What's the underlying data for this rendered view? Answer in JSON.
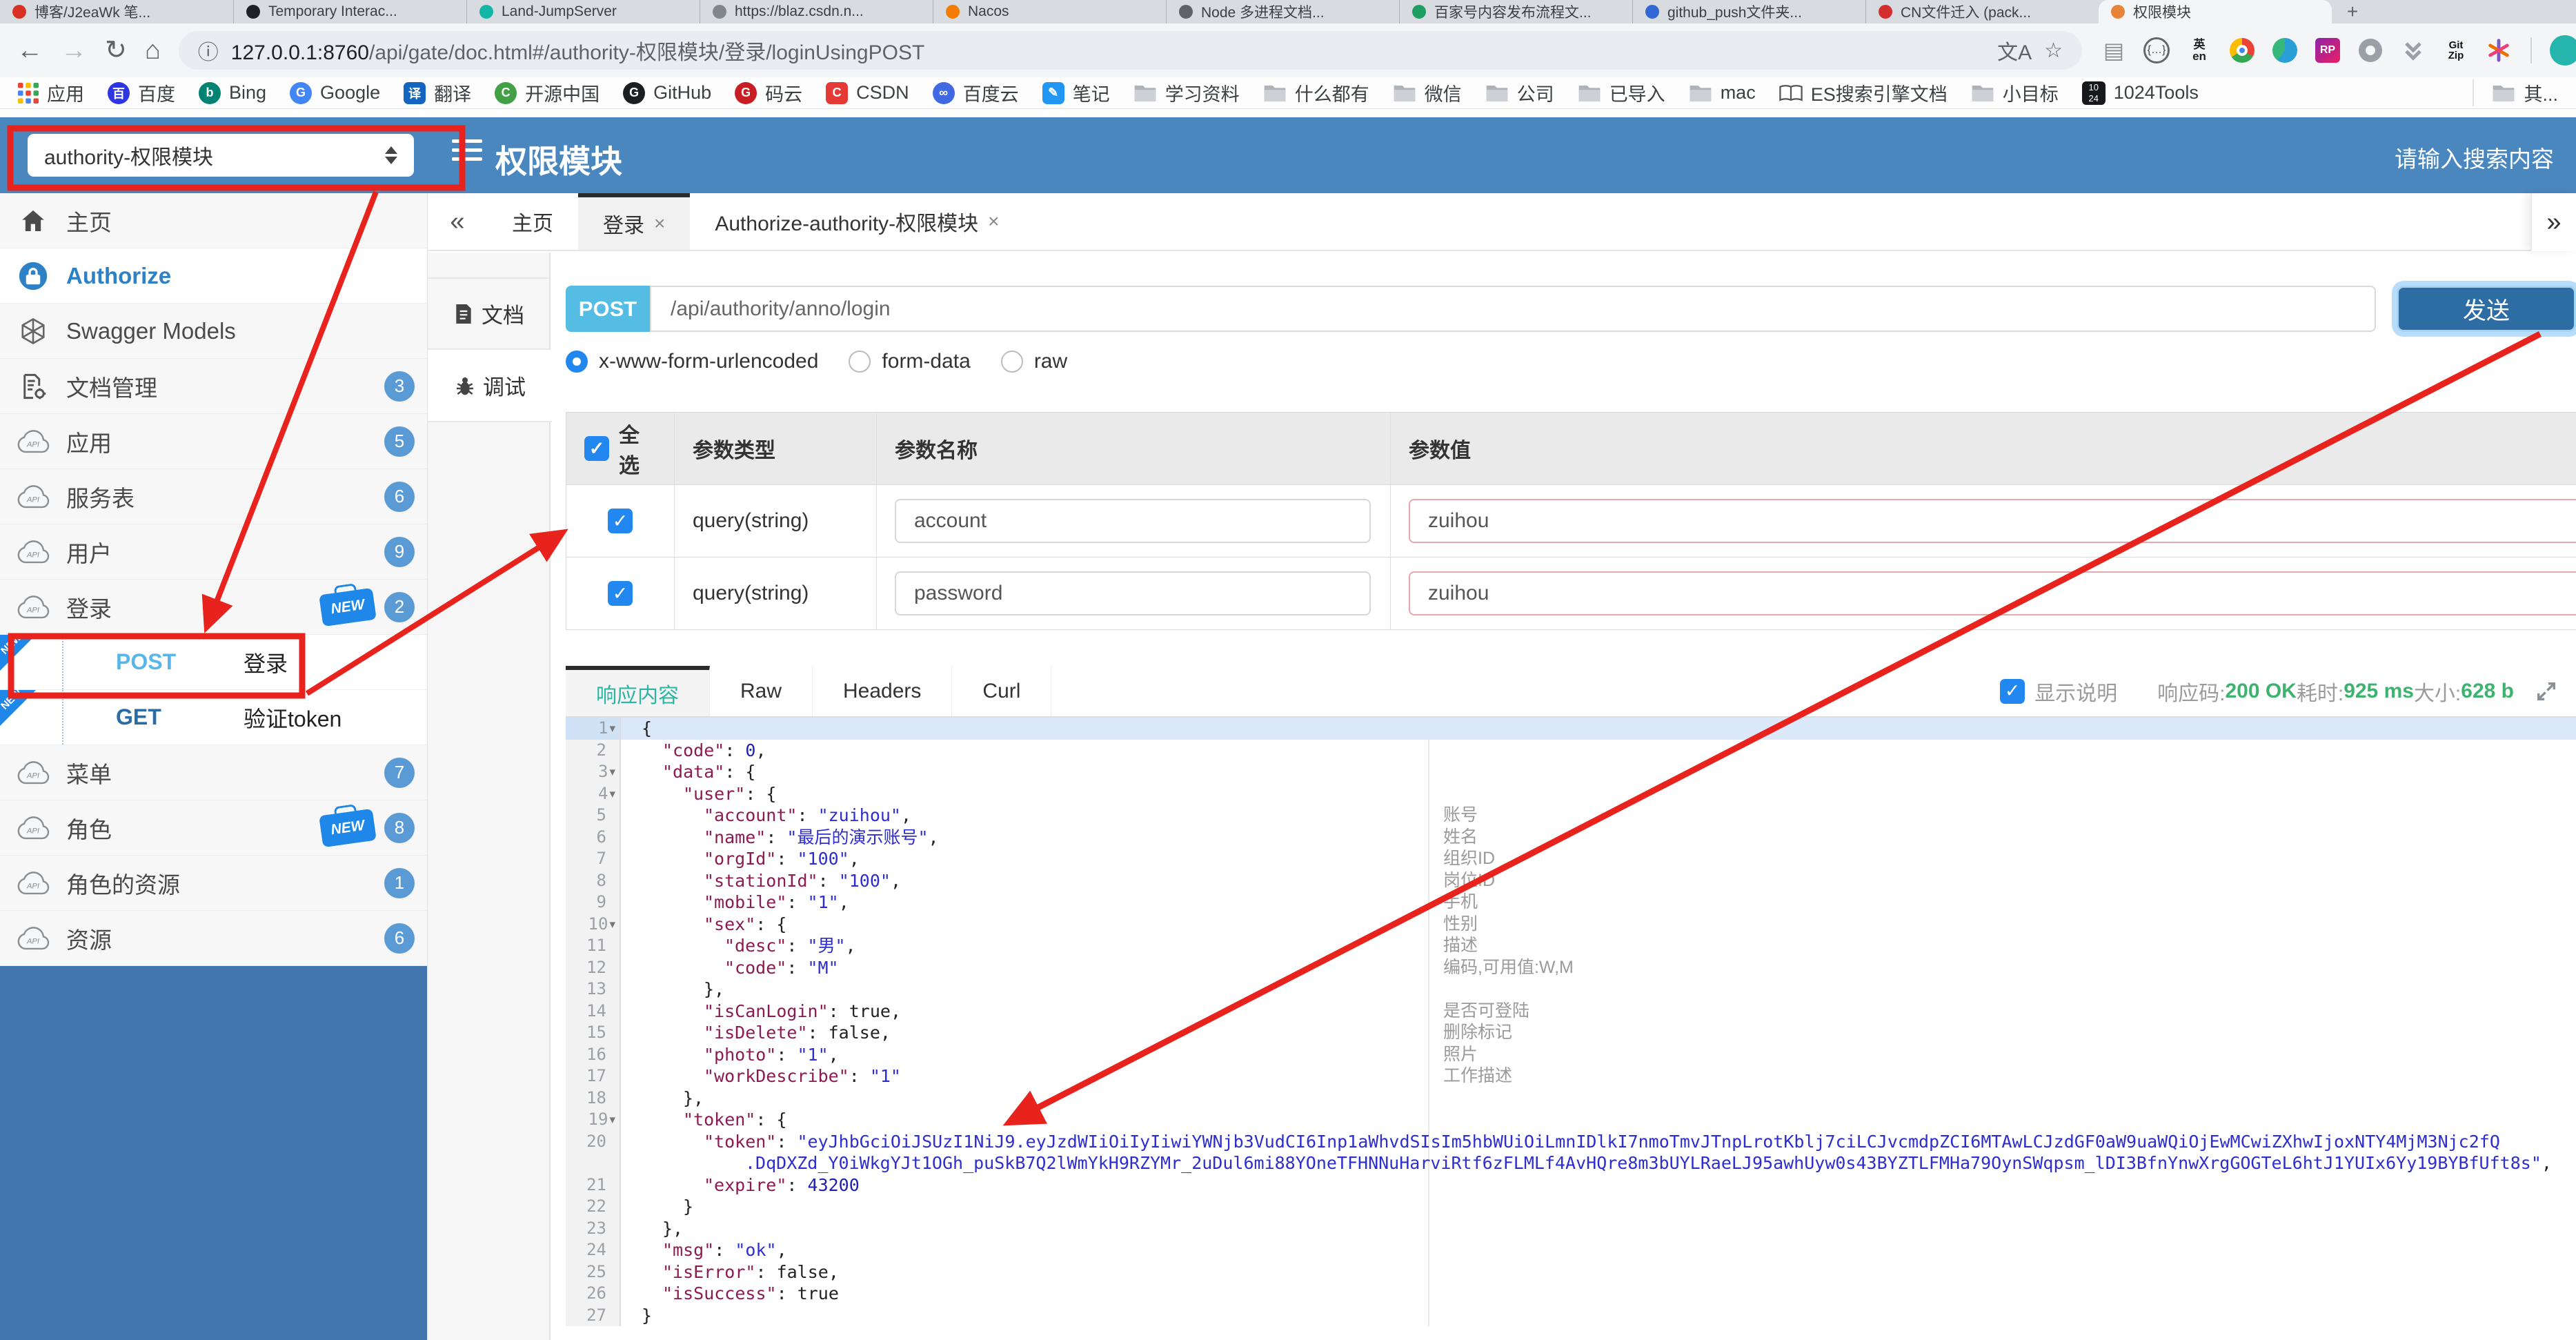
{
  "browser": {
    "tabs": [
      {
        "title": "博客/J2eaWk 笔...",
        "color": "#d93025"
      },
      {
        "title": "Temporary Interac...",
        "color": "#202124"
      },
      {
        "title": "Land-JumpServer",
        "color": "#12b7a6"
      },
      {
        "title": "https://blaz.csdn.n...",
        "color": "#80868b"
      },
      {
        "title": "Nacos",
        "color": "#f57c00"
      },
      {
        "title": "Node 多进程文档...",
        "color": "#5f6368"
      },
      {
        "title": "百家号内容发布流程文...",
        "color": "#1e9e63"
      },
      {
        "title": "github_push文件夹...",
        "color": "#3367d6"
      },
      {
        "title": "CN文件迁入 (pack...",
        "color": "#d32f2f"
      },
      {
        "title": "权限模块",
        "color": "#e8833a",
        "active": true
      }
    ],
    "new_tab_label": "+",
    "nav": {
      "back": "←",
      "forward": "→",
      "reload": "↻",
      "home": "⌂"
    },
    "url": {
      "info": "ⓘ",
      "host": "127.0.0.1:8760",
      "path": "/api/gate/doc.html#/authority-权限模块/登录/loginUsingPOST"
    },
    "actions": {
      "translate": "文A",
      "star": "☆"
    },
    "ext_icons": [
      "page-icon",
      "braces-icon",
      "en-translate-icon",
      "chrome-icon",
      "globe-icon",
      "rp-icon",
      "ring-icon",
      "double-chevron-icon",
      "gitzip-icon",
      "asterisk-icon"
    ],
    "gitzip_label": "Git Zip",
    "bookmarks": [
      {
        "label": "应用",
        "type": "apps"
      },
      {
        "label": "百度",
        "type": "dot",
        "color": "#2d36e0",
        "glyph": "百"
      },
      {
        "label": "Bing",
        "type": "dot",
        "color": "#008373",
        "glyph": "b"
      },
      {
        "label": "Google",
        "type": "dot",
        "color": "#4285f4",
        "glyph": "G"
      },
      {
        "label": "翻译",
        "type": "sq",
        "color": "#1565c0",
        "glyph": "译"
      },
      {
        "label": "开源中国",
        "type": "dot",
        "color": "#43a047",
        "glyph": "C"
      },
      {
        "label": "GitHub",
        "type": "dot",
        "color": "#1b1f23",
        "glyph": "G"
      },
      {
        "label": "码云",
        "type": "dot",
        "color": "#c71d23",
        "glyph": "G"
      },
      {
        "label": "CSDN",
        "type": "sq",
        "color": "#e53935",
        "glyph": "C"
      },
      {
        "label": "百度云",
        "type": "dot",
        "color": "#4169e1",
        "glyph": "∞"
      },
      {
        "label": "笔记",
        "type": "sq",
        "color": "#2196f3",
        "glyph": "✎"
      },
      {
        "label": "学习资料",
        "type": "folder"
      },
      {
        "label": "什么都有",
        "type": "folder"
      },
      {
        "label": "微信",
        "type": "folder"
      },
      {
        "label": "公司",
        "type": "folder"
      },
      {
        "label": "已导入",
        "type": "folder"
      },
      {
        "label": "mac",
        "type": "folder"
      },
      {
        "label": "ES搜索引擎文档",
        "type": "book"
      },
      {
        "label": "小目标",
        "type": "folder"
      },
      {
        "label": "1024Tools",
        "type": "tool1024",
        "glyph_top": "10",
        "glyph_bottom": "24"
      }
    ],
    "bookmarks_overflow": {
      "label": "其...",
      "type": "folder"
    }
  },
  "header": {
    "module_select": "authority-权限模块",
    "title": "权限模块",
    "search_placeholder": "请输入搜索内容"
  },
  "sidebar": {
    "items": [
      {
        "label": "主页",
        "icon": "home"
      },
      {
        "label": "Authorize",
        "icon": "lock",
        "active": true
      },
      {
        "label": "Swagger Models",
        "icon": "hexagon"
      },
      {
        "label": "文档管理",
        "icon": "doc-gear",
        "badge": "3"
      },
      {
        "label": "应用",
        "icon": "cloud",
        "badge": "5"
      },
      {
        "label": "服务表",
        "icon": "cloud",
        "badge": "6"
      },
      {
        "label": "用户",
        "icon": "cloud",
        "badge": "9"
      },
      {
        "label": "登录",
        "icon": "cloud",
        "badge": "2",
        "new": true
      },
      {
        "op": "POST",
        "label": "登录",
        "new": true
      },
      {
        "op": "GET",
        "label": "验证token",
        "new": true
      },
      {
        "label": "菜单",
        "icon": "cloud",
        "badge": "7"
      },
      {
        "label": "角色",
        "icon": "cloud",
        "badge": "8",
        "new": true
      },
      {
        "label": "角色的资源",
        "icon": "cloud",
        "badge": "1"
      },
      {
        "label": "资源",
        "icon": "cloud",
        "badge": "6"
      }
    ],
    "new_label": "NEW"
  },
  "content_tabs": {
    "collapse": "«",
    "expand": "»",
    "close_glyph": "×",
    "tabs": [
      {
        "label": "主页",
        "closable": false
      },
      {
        "label": "登录",
        "closable": true,
        "active": true
      },
      {
        "label": "Authorize-authority-权限模块",
        "closable": true
      }
    ]
  },
  "doc_tabs": [
    {
      "label": "文档",
      "icon": "doc"
    },
    {
      "label": "调试",
      "icon": "bug",
      "active": true
    }
  ],
  "request": {
    "method": "POST",
    "url": "/api/authority/anno/login",
    "send_label": "发送",
    "content_types": [
      {
        "label": "x-www-form-urlencoded",
        "selected": true
      },
      {
        "label": "form-data",
        "selected": false
      },
      {
        "label": "raw",
        "selected": false
      }
    ]
  },
  "params": {
    "headers": [
      "全选",
      "参数类型",
      "参数名称",
      "参数值"
    ],
    "rows": [
      {
        "checked": true,
        "type": "query(string)",
        "name": "account",
        "value": "zuihou"
      },
      {
        "checked": true,
        "type": "query(string)",
        "name": "password",
        "value": "zuihou"
      }
    ]
  },
  "response": {
    "tabs": [
      {
        "label": "响应内容",
        "active": true
      },
      {
        "label": "Raw",
        "active": false
      },
      {
        "label": "Headers",
        "active": false
      },
      {
        "label": "Curl",
        "active": false
      }
    ],
    "show_desc_label": "显示说明",
    "show_desc_checked": true,
    "metrics": [
      {
        "label": "响应码:",
        "value": "200 OK"
      },
      {
        "label": "耗时:",
        "value": "925 ms"
      },
      {
        "label": "大小:",
        "value": "628 b"
      }
    ]
  },
  "code": {
    "lines": [
      {
        "n": 1,
        "fold": 1,
        "hl": 1,
        "i": 0,
        "t": [
          [
            "{",
            "p"
          ]
        ]
      },
      {
        "n": 2,
        "i": 1,
        "t": [
          [
            "\"code\"",
            "k"
          ],
          [
            ": ",
            "p"
          ],
          [
            "0",
            "n"
          ],
          [
            ",",
            "p"
          ]
        ]
      },
      {
        "n": 3,
        "fold": 1,
        "i": 1,
        "t": [
          [
            "\"data\"",
            "k"
          ],
          [
            ": {",
            "p"
          ]
        ]
      },
      {
        "n": 4,
        "fold": 1,
        "i": 2,
        "t": [
          [
            "\"user\"",
            "k"
          ],
          [
            ": {",
            "p"
          ]
        ]
      },
      {
        "n": 5,
        "i": 3,
        "ann": "账号",
        "t": [
          [
            "\"account\"",
            "k"
          ],
          [
            ": ",
            "p"
          ],
          [
            "\"zuihou\"",
            "s"
          ],
          [
            ",",
            "p"
          ]
        ]
      },
      {
        "n": 6,
        "i": 3,
        "ann": "姓名",
        "t": [
          [
            "\"name\"",
            "k"
          ],
          [
            ": ",
            "p"
          ],
          [
            "\"最后的演示账号\"",
            "s"
          ],
          [
            ",",
            "p"
          ]
        ]
      },
      {
        "n": 7,
        "i": 3,
        "ann": "组织ID",
        "t": [
          [
            "\"orgId\"",
            "k"
          ],
          [
            ": ",
            "p"
          ],
          [
            "\"100\"",
            "s"
          ],
          [
            ",",
            "p"
          ]
        ]
      },
      {
        "n": 8,
        "i": 3,
        "ann": "岗位ID",
        "t": [
          [
            "\"stationId\"",
            "k"
          ],
          [
            ": ",
            "p"
          ],
          [
            "\"100\"",
            "s"
          ],
          [
            ",",
            "p"
          ]
        ]
      },
      {
        "n": 9,
        "i": 3,
        "ann": "手机",
        "t": [
          [
            "\"mobile\"",
            "k"
          ],
          [
            ": ",
            "p"
          ],
          [
            "\"1\"",
            "s"
          ],
          [
            ",",
            "p"
          ]
        ]
      },
      {
        "n": 10,
        "fold": 1,
        "i": 3,
        "ann": "性别",
        "t": [
          [
            "\"sex\"",
            "k"
          ],
          [
            ": {",
            "p"
          ]
        ]
      },
      {
        "n": 11,
        "i": 4,
        "ann": "描述",
        "t": [
          [
            "\"desc\"",
            "k"
          ],
          [
            ": ",
            "p"
          ],
          [
            "\"男\"",
            "s"
          ],
          [
            ",",
            "p"
          ]
        ]
      },
      {
        "n": 12,
        "i": 4,
        "ann": "编码,可用值:W,M",
        "t": [
          [
            "\"code\"",
            "k"
          ],
          [
            ": ",
            "p"
          ],
          [
            "\"M\"",
            "s"
          ]
        ]
      },
      {
        "n": 13,
        "i": 3,
        "t": [
          [
            "},",
            "p"
          ]
        ]
      },
      {
        "n": 14,
        "i": 3,
        "ann": "是否可登陆",
        "t": [
          [
            "\"isCanLogin\"",
            "k"
          ],
          [
            ": ",
            "p"
          ],
          [
            "true,",
            "p"
          ]
        ]
      },
      {
        "n": 15,
        "i": 3,
        "ann": "删除标记",
        "t": [
          [
            "\"isDelete\"",
            "k"
          ],
          [
            ": ",
            "p"
          ],
          [
            "false,",
            "p"
          ]
        ]
      },
      {
        "n": 16,
        "i": 3,
        "ann": "照片",
        "t": [
          [
            "\"photo\"",
            "k"
          ],
          [
            ": ",
            "p"
          ],
          [
            "\"1\"",
            "s"
          ],
          [
            ",",
            "p"
          ]
        ]
      },
      {
        "n": 17,
        "i": 3,
        "ann": "工作描述",
        "t": [
          [
            "\"workDescribe\"",
            "k"
          ],
          [
            ": ",
            "p"
          ],
          [
            "\"1\"",
            "s"
          ]
        ]
      },
      {
        "n": 18,
        "i": 2,
        "t": [
          [
            "},",
            "p"
          ]
        ]
      },
      {
        "n": 19,
        "fold": 1,
        "i": 2,
        "t": [
          [
            "\"token\"",
            "k"
          ],
          [
            ": {",
            "p"
          ]
        ]
      },
      {
        "n": 20,
        "i": 3,
        "t": [
          [
            "\"token\"",
            "k"
          ],
          [
            ": ",
            "p"
          ],
          [
            "\"eyJhbGciOiJSUzI1NiJ9.eyJzdWIiOiIyIiwiYWNjb3VudCI6Inp1aWhvdSIsIm5hbWUiOiLmnIDlkI7nmoTmvJTnpLrotKblj7ciLCJvcmdpZCI6MTAwLCJzdGF0aW9uaWQiOjEwMCwiZXhwIjoxNTY4MjM3Njc2fQ",
            "s"
          ]
        ]
      },
      {
        "wrap": 1,
        "i": 5,
        "t": [
          [
            ".DqDXZd_Y0iWkgYJt1OGh_puSkB7Q2lWmYkH9RZYMr_2uDul6mi88YOneTFHNNuHarviRtf6zFLMLf4AvHQre8m3bUYLRaeLJ95awhUyw0s43BYZTLFMHa79OynSWqpsm_lDI3BfnYnwXrgGOGTeL6htJ1YUIx6Yy19BYBfUft8s\"",
            "s"
          ],
          [
            ",",
            "p"
          ]
        ]
      },
      {
        "n": 21,
        "i": 3,
        "t": [
          [
            "\"expire\"",
            "k"
          ],
          [
            ": ",
            "p"
          ],
          [
            "43200",
            "n"
          ]
        ]
      },
      {
        "n": 22,
        "i": 2,
        "t": [
          [
            "}",
            "p"
          ]
        ]
      },
      {
        "n": 23,
        "i": 1,
        "t": [
          [
            "},",
            "p"
          ]
        ]
      },
      {
        "n": 24,
        "i": 1,
        "t": [
          [
            "\"msg\"",
            "k"
          ],
          [
            ": ",
            "p"
          ],
          [
            "\"ok\"",
            "s"
          ],
          [
            ",",
            "p"
          ]
        ]
      },
      {
        "n": 25,
        "i": 1,
        "t": [
          [
            "\"isError\"",
            "k"
          ],
          [
            ": ",
            "p"
          ],
          [
            "false,",
            "p"
          ]
        ]
      },
      {
        "n": 26,
        "i": 1,
        "t": [
          [
            "\"isSuccess\"",
            "k"
          ],
          [
            ": ",
            "p"
          ],
          [
            "true",
            "p"
          ]
        ]
      },
      {
        "n": 27,
        "i": 0,
        "t": [
          [
            "}",
            "p"
          ]
        ]
      }
    ]
  },
  "colors": {
    "accent_blue": "#4a87bf",
    "post_badge": "#55bce3",
    "send_button": "#2e6da4",
    "success_green": "#3eb370",
    "annotation_red": "#e8231d",
    "badge_blue": "#5b9bd5",
    "new_blue": "#1f87e8",
    "active_teal": "#2bb5a3"
  }
}
